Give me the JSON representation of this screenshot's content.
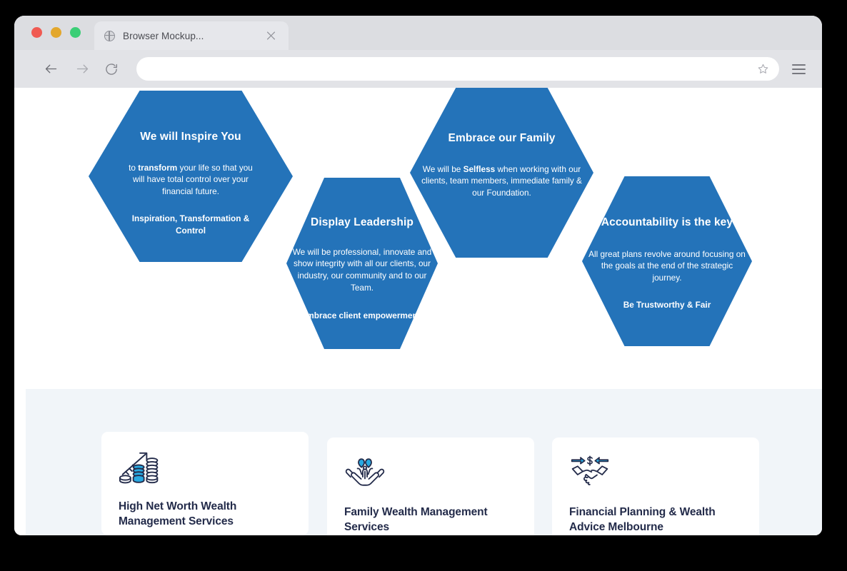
{
  "browser": {
    "traffic_lights": [
      {
        "name": "close",
        "color": "#f05a52"
      },
      {
        "name": "minimize",
        "color": "#e3a72c"
      },
      {
        "name": "maximize",
        "color": "#3bce76"
      }
    ],
    "tab": {
      "title": "Browser Mockup...",
      "favicon": "globe-icon",
      "close": "close-icon"
    },
    "toolbar": {
      "back": "back-arrow-icon",
      "forward": "forward-arrow-icon",
      "reload": "reload-icon",
      "bookmark": "star-icon",
      "menu": "hamburger-menu-icon",
      "address_value": "",
      "address_placeholder": ""
    }
  },
  "colors": {
    "hex_blue": "#2473b9",
    "band_background": "#f1f5f9",
    "card_title": "#232b4a",
    "icon_accent": "#29a9e1",
    "icon_dark": "#232b4a"
  },
  "hexagons": [
    {
      "title": "We will Inspire You",
      "body_lead": "to ",
      "body_bold": "transform",
      "body_rest": " your life so that you will have total control over your financial future.",
      "tagline": "Inspiration, Transformation & Control"
    },
    {
      "title": "Display Leadership",
      "body": "We will be professional, innovate and show integrity with all our clients, our industry, our community and to our Team.",
      "tagline": "Embrace client empowerment!"
    },
    {
      "title": "Embrace our Family",
      "body_lead": "We will be ",
      "body_bold": "Selfless",
      "body_rest": " when working with our clients, team members, immediate family & our Foundation.",
      "tagline": ""
    },
    {
      "title": "Accountability is the key",
      "body": "All great plans revolve around focusing on the goals at the end of the strategic journey.",
      "tagline": "Be Trustworthy & Fair"
    }
  ],
  "cards": [
    {
      "icon": "coins-growth-arrow-icon",
      "title": "High Net Worth Wealth Management Services"
    },
    {
      "icon": "hands-holding-family-icon",
      "title": "Family Wealth Management Services"
    },
    {
      "icon": "handshake-dollar-exchange-icon",
      "title": "Financial Planning & Wealth Advice Melbourne"
    }
  ]
}
